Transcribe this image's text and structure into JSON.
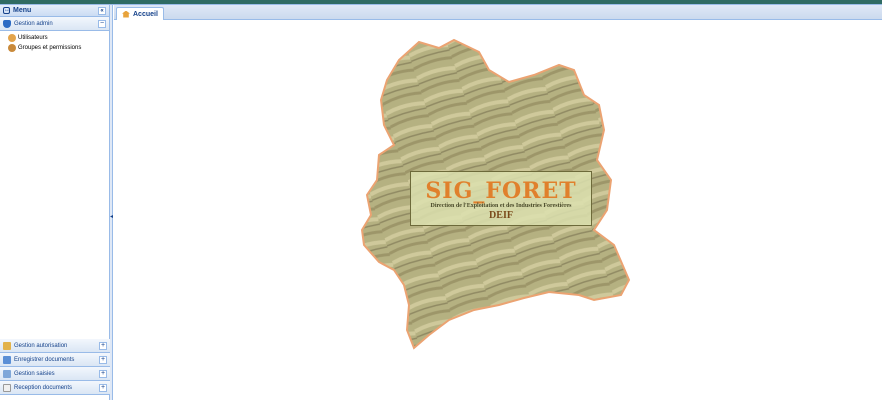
{
  "sidebar": {
    "title": "Menu",
    "collapse_symbol": "«",
    "sections": [
      {
        "label": "Gestion admin",
        "icon": "shield-icon",
        "tool": "−",
        "expanded": true,
        "items": [
          {
            "label": "Utilisateurs",
            "icon": "user-icon"
          },
          {
            "label": "Groupes et permissions",
            "icon": "users-icon"
          }
        ]
      }
    ],
    "bottom_sections": [
      {
        "label": "Gestion autorisation",
        "icon": "key-icon",
        "tool": "+"
      },
      {
        "label": "Enregistrer documents",
        "icon": "document-icon",
        "tool": "+"
      },
      {
        "label": "Gestion saisies",
        "icon": "folder-icon",
        "tool": "+"
      },
      {
        "label": "Reception documents",
        "icon": "inbox-icon",
        "tool": "+"
      }
    ]
  },
  "main": {
    "tabs": [
      {
        "label": "Accueil",
        "icon": "home-icon",
        "active": true
      }
    ],
    "splash": {
      "title": "SIG_FORET",
      "subtitle": "Direction de l'Exploitation et des Industries Forestières",
      "abbreviation": "DEIF"
    }
  },
  "colors": {
    "header_bar": "#2f6b63",
    "panel_border": "#99bbe8",
    "title_orange": "#e0802c",
    "map_fill": "#a9a46c",
    "map_outline": "#e8935a"
  }
}
